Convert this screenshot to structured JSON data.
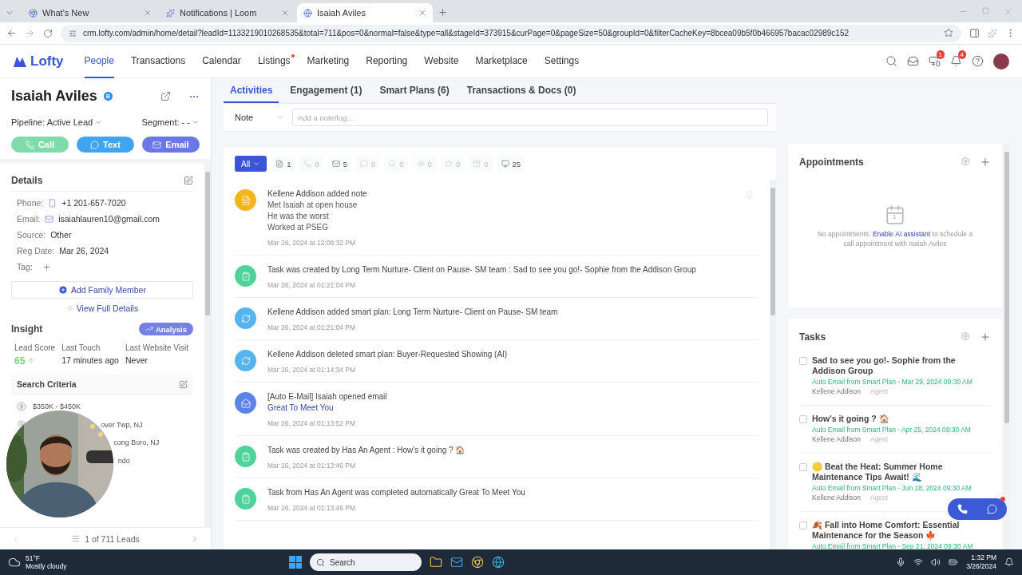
{
  "browser": {
    "tabs": [
      {
        "title": "What's New",
        "selected": false,
        "kind": "chrome"
      },
      {
        "title": "Notifications | Loom",
        "selected": false,
        "kind": "loom"
      },
      {
        "title": "Isaiah Aviles",
        "selected": true,
        "kind": "lofty"
      }
    ],
    "url": "crm.lofty.com/admin/home/detail?leadId=1133219010268535&total=711&pos=0&normal=false&type=all&stageId=373915&curPage=0&pageSize=50&groupId=0&filterCacheKey=8bcea09b5f0b466957bacac02989c152"
  },
  "app_nav": {
    "logo": "Lofty",
    "items": [
      {
        "label": "People",
        "selected": true,
        "dot": false
      },
      {
        "label": "Transactions",
        "selected": false,
        "dot": false
      },
      {
        "label": "Calendar",
        "selected": false,
        "dot": false
      },
      {
        "label": "Listings",
        "selected": false,
        "dot": true
      },
      {
        "label": "Marketing",
        "selected": false,
        "dot": false
      },
      {
        "label": "Reporting",
        "selected": false,
        "dot": false
      },
      {
        "label": "Website",
        "selected": false,
        "dot": false
      },
      {
        "label": "Marketplace",
        "selected": false,
        "dot": false
      },
      {
        "label": "Settings",
        "selected": false,
        "dot": false
      }
    ],
    "tools": [
      {
        "kind": "search"
      },
      {
        "kind": "inbox"
      },
      {
        "kind": "monitor",
        "badge": "1"
      },
      {
        "kind": "bell",
        "badge": "4"
      },
      {
        "kind": "help"
      },
      {
        "kind": "avatar"
      }
    ]
  },
  "lead": {
    "name": "Isaiah Aviles",
    "badge": "B",
    "pipeline": "Pipeline: Active Lead",
    "segment": "Segment: - -",
    "actions": [
      {
        "label": "Call",
        "kind": "call",
        "color": "#7fdcaa"
      },
      {
        "label": "Text",
        "kind": "text",
        "color": "#3fa5f0"
      },
      {
        "label": "Email",
        "kind": "email",
        "color": "#6a78e6"
      }
    ]
  },
  "details": {
    "title": "Details",
    "fields": [
      {
        "label": "Phone:",
        "value": "+1 201-657-7020",
        "kind": "phone"
      },
      {
        "label": "Email:",
        "value": "isaiahlauren10@gmail.com",
        "kind": "email"
      },
      {
        "label": "Source:",
        "value": "Other",
        "kind": "plain"
      },
      {
        "label": "Reg Date:",
        "value": "Mar 26, 2024",
        "kind": "plain"
      },
      {
        "label": "Tag:",
        "kind": "add"
      }
    ],
    "add_family": "Add Family Member",
    "view_full": "View Full Details"
  },
  "insight": {
    "title": "Insight",
    "analysis": "Analysis",
    "stats": [
      {
        "label": "Lead Score",
        "value": "65",
        "kind": "score"
      },
      {
        "label": "Last Touch",
        "value": "17 minutes ago",
        "kind": "plain"
      },
      {
        "label": "Last Website Visit",
        "value": "Never",
        "kind": "plain"
      }
    ],
    "search_criteria": {
      "title": "Search Criteria",
      "items": [
        {
          "kind": "price",
          "text": "$350K - $450K"
        },
        {
          "kind": "location",
          "text": "over Twp, NJ"
        },
        {
          "kind": "hidden",
          "text": "cong Boro, NJ"
        },
        {
          "kind": "hidden",
          "text": "ndo"
        }
      ]
    }
  },
  "pager": "1 of 711 Leads",
  "main_tabs": [
    {
      "label": "Activities",
      "selected": true
    },
    {
      "label": "Engagement (1)",
      "selected": false
    },
    {
      "label": "Smart Plans (6)",
      "selected": false
    },
    {
      "label": "Transactions & Docs (0)",
      "selected": false
    }
  ],
  "note": {
    "type": "Note",
    "placeholder": "Add a note/log..."
  },
  "filters": {
    "all": {
      "label": "All",
      "selected": true
    },
    "chips": [
      {
        "kind": "note",
        "count": "1",
        "disabled": false
      },
      {
        "kind": "call",
        "count": "0",
        "disabled": true
      },
      {
        "kind": "email",
        "count": "5",
        "disabled": false
      },
      {
        "kind": "text",
        "count": "0",
        "disabled": true
      },
      {
        "kind": "chat",
        "count": "0",
        "disabled": true
      },
      {
        "kind": "view",
        "count": "0",
        "disabled": true
      },
      {
        "kind": "star",
        "count": "0",
        "disabled": true
      },
      {
        "kind": "box",
        "count": "0",
        "disabled": true
      },
      {
        "kind": "desktop",
        "count": "25",
        "disabled": false
      }
    ]
  },
  "activities": [
    {
      "kind": "note",
      "title": "Kellene Addison added note",
      "body": [
        "Met Isaiah at open house",
        "He was the worst",
        "Worked at PSEG"
      ],
      "time": "Mar 26, 2024 at 12:08:32 PM",
      "pinnable": true
    },
    {
      "kind": "task",
      "title": "Task was created by Long Term Nurture- Client on Pause- SM team : Sad to see you go!- Sophie from the Addison Group",
      "time": "Mar 26, 2024 at 01:21:04 PM",
      "pinnable": false
    },
    {
      "kind": "plan",
      "title": "Kellene Addison added smart plan: Long Term Nurture- Client on Pause- SM team",
      "time": "Mar 26, 2024 at 01:21:04 PM",
      "pinnable": false
    },
    {
      "kind": "plan",
      "title": "Kellene Addison deleted smart plan: Buyer-Requested Showing (AI)",
      "time": "Mar 26, 2024 at 01:14:34 PM",
      "pinnable": false
    },
    {
      "kind": "email",
      "title": "[Auto E-Mail] Isaiah opened email",
      "link": "Great To Meet You",
      "time": "Mar 26, 2024 at 01:13:52 PM",
      "pinnable": false
    },
    {
      "kind": "task",
      "title": "Task was created by Has An Agent : How's it going ? 🏠",
      "time": "Mar 26, 2024 at 01:13:46 PM",
      "pinnable": false
    },
    {
      "kind": "task",
      "title": "Task from Has An Agent was completed automatically Great To Meet You",
      "time": "Mar 26, 2024 at 01:13:46 PM",
      "pinnable": false
    }
  ],
  "appointments": {
    "title": "Appointments",
    "calendar_day": "1",
    "empty_before": "No appointments.",
    "empty_link": "Enable AI assistant",
    "empty_after": "to schedule a call appointment with Isaiah Aviles"
  },
  "tasks": {
    "title": "Tasks",
    "items": [
      {
        "title": "Sad to see you go!- Sophie from the Addison Group",
        "subtitle": "Auto Email from Smart Plan - Mar 29, 2024 09:30 AM",
        "owner": "Kellene Addison",
        "role": "Agent",
        "checked": false
      },
      {
        "title": "How's it going ? 🏠",
        "subtitle": "Auto Email from Smart Plan - Apr 25, 2024 09:30 AM",
        "owner": "Kellene Addison",
        "role": "Agent",
        "checked": false
      },
      {
        "title": "🟡 Beat the Heat: Summer Home Maintenance Tips Await! 🌊",
        "subtitle": "Auto Email from Smart Plan - Jun 18, 2024 09:30 AM",
        "owner": "Kellene Addison",
        "role": "Agent",
        "checked": false
      },
      {
        "title": "🍂 Fall into Home Comfort: Essential Maintenance for the Season 🍁",
        "subtitle": "Auto Email from Smart Plan - Sep 21, 2024 09:30 AM",
        "checked": false
      }
    ]
  },
  "float_actions": {
    "chat_unread": true
  },
  "taskbar": {
    "temp": "51°F",
    "weather": "Mostly cloudy",
    "search": "Search",
    "time": "1:32 PM",
    "date": "3/26/2024"
  }
}
